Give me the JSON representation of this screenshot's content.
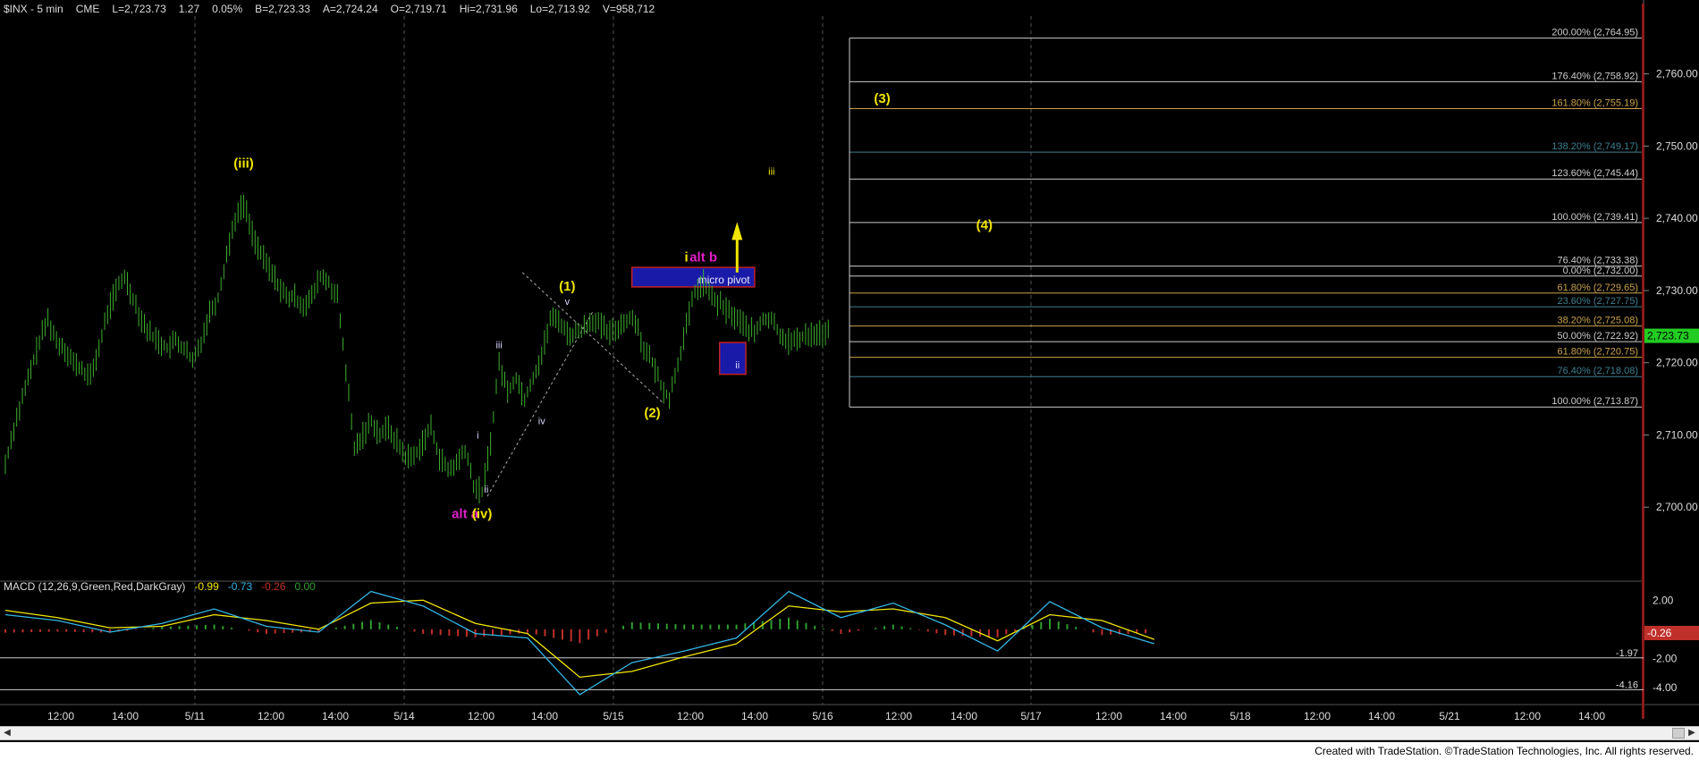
{
  "colors": {
    "bg": "#000000",
    "price": "#3fae2f",
    "grid": "#4a4a4a",
    "fib_gold": "#c9a24b",
    "fib_teal": "#3f7f8f",
    "fib_white": "#cccccc",
    "label_yellow": "#f2e600",
    "label_magenta": "#e020c8",
    "label_white": "#d8d8ff",
    "macd_line": "#33b5e5",
    "signal_line": "#f2e600",
    "hist_pos": "#2e9e2e",
    "hist_neg": "#c0302a",
    "last_price_bg": "#22cc22",
    "pivot_box": "#1a1aa8",
    "pivot_border": "#c02020"
  },
  "header": {
    "symbol": "$INX - 5 min",
    "exchange": "CME",
    "last": "L=2,723.73",
    "change": "1.27",
    "change_pct": "0.05%",
    "bid": "B=2,723.33",
    "ask": "A=2,724.24",
    "open": "O=2,719.71",
    "high": "Hi=2,731.96",
    "low": "Lo=2,713.92",
    "volume": "V=958,712"
  },
  "chart_data": [
    {
      "type": "line",
      "title": "$INX - 5 min",
      "ylim": [
        2690,
        2768
      ],
      "y_ticks": [
        "2,700.00",
        "2,710.00",
        "2,720.00",
        "2,730.00",
        "2,740.00",
        "2,750.00",
        "2,760.00"
      ],
      "x_tick_labels": [
        "12:00",
        "14:00",
        "5/11",
        "12:00",
        "14:00",
        "5/14",
        "12:00",
        "14:00",
        "5/15",
        "12:00",
        "14:00",
        "5/16",
        "12:00",
        "14:00",
        "5/17",
        "12:00",
        "14:00",
        "5/18",
        "12:00",
        "14:00",
        "5/21",
        "12:00",
        "14:00"
      ],
      "session_separators": [
        "5/11",
        "5/14",
        "5/15",
        "5/16",
        "5/17"
      ],
      "last_price": "2,723.73",
      "series": [
        {
          "name": "$INX",
          "x": [
            0,
            2,
            4,
            6,
            8,
            10,
            12,
            14,
            16,
            18,
            20,
            22,
            24,
            26,
            28,
            30,
            32,
            34,
            36,
            38,
            40,
            42,
            44,
            46,
            48,
            50,
            52,
            54,
            56,
            58,
            60,
            62,
            64,
            66,
            68,
            70,
            72,
            74,
            76,
            78,
            80,
            82,
            84,
            86,
            88,
            90,
            92,
            94,
            96,
            98,
            100,
            102,
            104,
            106,
            108,
            110,
            112,
            114,
            116,
            118,
            120,
            122,
            124,
            126,
            128,
            130,
            132,
            134,
            136,
            138,
            140,
            142,
            144,
            146,
            148,
            150,
            152,
            154,
            156,
            158,
            160,
            162,
            164,
            166,
            168,
            170,
            172,
            174,
            176,
            178,
            180,
            182,
            184,
            186,
            188,
            190,
            192,
            194
          ],
          "y": [
            2706,
            2711,
            2715,
            2719,
            2723,
            2726,
            2723,
            2722,
            2720,
            2719,
            2718,
            2722,
            2727,
            2730,
            2732,
            2729,
            2726,
            2724,
            2723,
            2722,
            2723,
            2722,
            2720,
            2723,
            2727,
            2729,
            2735,
            2740,
            2742,
            2738,
            2735,
            2733,
            2731,
            2729,
            2729,
            2728,
            2729,
            2732,
            2731,
            2729,
            2719,
            2708,
            2710,
            2712,
            2710,
            2711,
            2709,
            2707,
            2707,
            2709,
            2711,
            2707,
            2705,
            2706,
            2708,
            2703,
            2702,
            2709,
            2720,
            2716,
            2718,
            2715,
            2718,
            2721,
            2726,
            2726,
            2724,
            2724,
            2725,
            2726,
            2725,
            2724,
            2725,
            2726,
            2726,
            2722,
            2720,
            2717,
            2715,
            2720,
            2725,
            2730,
            2731,
            2729,
            2728,
            2727,
            2726,
            2725,
            2724,
            2726,
            2726,
            2724,
            2723,
            2723,
            2724,
            2724,
            2724,
            2724
          ]
        }
      ],
      "fib_levels": [
        {
          "label": "200.00% (2,764.95)",
          "value": 2764.95,
          "color": "#cccccc"
        },
        {
          "label": "176.40% (2,758.92)",
          "value": 2758.92,
          "color": "#cccccc"
        },
        {
          "label": "161.80% (2,755.19)",
          "value": 2755.19,
          "color": "#c9a24b"
        },
        {
          "label": "138.20% (2,749.17)",
          "value": 2749.17,
          "color": "#3f7f8f"
        },
        {
          "label": "123.60% (2,745.44)",
          "value": 2745.44,
          "color": "#cccccc"
        },
        {
          "label": "100.00% (2,739.41)",
          "value": 2739.41,
          "color": "#cccccc"
        },
        {
          "label": "76.40% (2,733.38)",
          "value": 2733.38,
          "color": "#cccccc"
        },
        {
          "label": "0.00% (2,732.00)",
          "value": 2732.0,
          "color": "#cccccc"
        },
        {
          "label": "61.80% (2,729.65)",
          "value": 2729.65,
          "color": "#c9a24b"
        },
        {
          "label": "23.60% (2,727.75)",
          "value": 2727.75,
          "color": "#3f7f8f"
        },
        {
          "label": "38.20% (2,725.08)",
          "value": 2725.08,
          "color": "#c9a24b"
        },
        {
          "label": "50.00% (2,722.92)",
          "value": 2722.92,
          "color": "#cccccc"
        },
        {
          "label": "61.80% (2,720.75)",
          "value": 2720.75,
          "color": "#c9a24b"
        },
        {
          "label": "76.40% (2,718.08)",
          "value": 2718.08,
          "color": "#3f7f8f"
        },
        {
          "label": "100.00% (2,713.87)",
          "value": 2713.87,
          "color": "#cccccc"
        }
      ],
      "wave_labels": [
        {
          "text": "(iii)",
          "x": 28,
          "y": 2747,
          "color": "#f2e600"
        },
        {
          "text": "alt a",
          "x": 54,
          "y": 2698.5,
          "color": "#e020c8"
        },
        {
          "text": "(iv)",
          "x": 56,
          "y": 2698.5,
          "color": "#f2e600"
        },
        {
          "text": "i",
          "x": 55.5,
          "y": 2709.5,
          "color": "#d8d8ff"
        },
        {
          "text": "ii",
          "x": 56.5,
          "y": 2702,
          "color": "#d8d8ff"
        },
        {
          "text": "iii",
          "x": 58,
          "y": 2722,
          "color": "#d8d8ff"
        },
        {
          "text": "iv",
          "x": 63,
          "y": 2711.5,
          "color": "#d8d8ff"
        },
        {
          "text": "v",
          "x": 66,
          "y": 2728,
          "color": "#d8d8ff"
        },
        {
          "text": "(1)",
          "x": 66,
          "y": 2730,
          "color": "#f2e600"
        },
        {
          "text": "(2)",
          "x": 76,
          "y": 2712.5,
          "color": "#f2e600"
        },
        {
          "text": "i",
          "x": 80,
          "y": 2734,
          "color": "#f2e600"
        },
        {
          "text": "alt b",
          "x": 82,
          "y": 2734,
          "color": "#e020c8"
        },
        {
          "text": "ii",
          "x": 86,
          "y": 2719.2,
          "color": "#d8d8ff"
        },
        {
          "text": "iii",
          "x": 90,
          "y": 2746,
          "color": "#f2e600"
        },
        {
          "text": "(3)",
          "x": 103,
          "y": 2756,
          "color": "#f2e600"
        },
        {
          "text": "(4)",
          "x": 115,
          "y": 2738.5,
          "color": "#f2e600"
        }
      ],
      "micro_pivot_label": "micro pivot"
    },
    {
      "type": "line",
      "title": "MACD (12,26,9,Green,Red,DarkGray)",
      "values_header": [
        "-0.99",
        "-0.73",
        "-0.26",
        "0.00"
      ],
      "values_header_colors": [
        "#f2e600",
        "#33b5e5",
        "#c0302a",
        "#2e9e2e"
      ],
      "ylim": [
        -5,
        3
      ],
      "y_ticks": [
        "2.00",
        "-2.00",
        "-4.00"
      ],
      "ref_lines": [
        {
          "label": "-1.97",
          "value": -1.97
        },
        {
          "label": "-4.16",
          "value": -4.16
        }
      ],
      "last_value": "-0.26",
      "x": [
        0,
        4,
        8,
        12,
        16,
        20,
        24,
        28,
        32,
        36,
        40,
        44,
        48,
        52,
        56,
        60,
        64,
        68,
        72,
        76,
        80,
        84,
        88
      ],
      "series": [
        {
          "name": "MACD",
          "values": [
            1.0,
            0.6,
            -0.2,
            0.4,
            1.4,
            0.2,
            -0.2,
            2.6,
            1.6,
            -0.3,
            -0.6,
            -4.5,
            -2.3,
            -1.5,
            -0.6,
            2.6,
            0.8,
            1.8,
            0.3,
            -1.5,
            1.9,
            0.1,
            -1.0
          ]
        },
        {
          "name": "Signal",
          "values": [
            1.3,
            0.8,
            0.1,
            0.2,
            1.0,
            0.6,
            0.0,
            1.8,
            2.0,
            0.4,
            -0.3,
            -3.3,
            -2.9,
            -1.9,
            -1.0,
            1.6,
            1.2,
            1.4,
            0.8,
            -0.8,
            1.0,
            0.6,
            -0.7
          ]
        }
      ]
    }
  ],
  "footer": {
    "credit": "Created with TradeStation. ©TradeStation Technologies, Inc. All rights reserved."
  }
}
